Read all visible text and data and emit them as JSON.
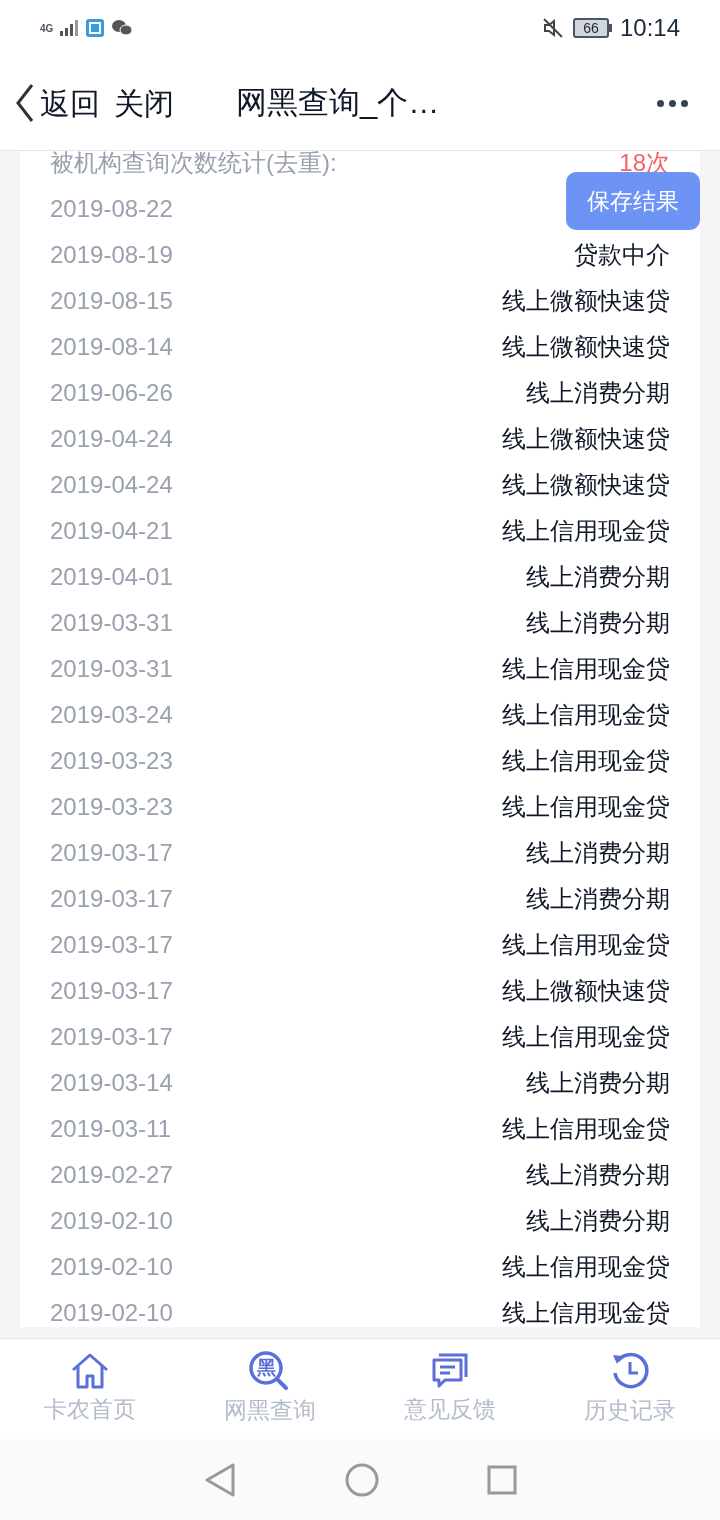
{
  "status_bar": {
    "network": "4G",
    "battery": "66",
    "time": "10:14"
  },
  "header": {
    "back": "返回",
    "close": "关闭",
    "title": "网黑查询_个…"
  },
  "summary": {
    "label": "被机构查询次数统计(去重):",
    "value": "18次"
  },
  "save_button": "保存结果",
  "rows": [
    {
      "date": "2019-08-22"
    },
    {
      "date": "2019-08-19",
      "type": "贷款中介"
    },
    {
      "date": "2019-08-15",
      "type": "线上微额快速贷"
    },
    {
      "date": "2019-08-14",
      "type": "线上微额快速贷"
    },
    {
      "date": "2019-06-26",
      "type": "线上消费分期"
    },
    {
      "date": "2019-04-24",
      "type": "线上微额快速贷"
    },
    {
      "date": "2019-04-24",
      "type": "线上微额快速贷"
    },
    {
      "date": "2019-04-21",
      "type": "线上信用现金贷"
    },
    {
      "date": "2019-04-01",
      "type": "线上消费分期"
    },
    {
      "date": "2019-03-31",
      "type": "线上消费分期"
    },
    {
      "date": "2019-03-31",
      "type": "线上信用现金贷"
    },
    {
      "date": "2019-03-24",
      "type": "线上信用现金贷"
    },
    {
      "date": "2019-03-23",
      "type": "线上信用现金贷"
    },
    {
      "date": "2019-03-23",
      "type": "线上信用现金贷"
    },
    {
      "date": "2019-03-17",
      "type": "线上消费分期"
    },
    {
      "date": "2019-03-17",
      "type": "线上消费分期"
    },
    {
      "date": "2019-03-17",
      "type": "线上信用现金贷"
    },
    {
      "date": "2019-03-17",
      "type": "线上微额快速贷"
    },
    {
      "date": "2019-03-17",
      "type": "线上信用现金贷"
    },
    {
      "date": "2019-03-14",
      "type": "线上消费分期"
    },
    {
      "date": "2019-03-11",
      "type": "线上信用现金贷"
    },
    {
      "date": "2019-02-27",
      "type": "线上消费分期"
    },
    {
      "date": "2019-02-10",
      "type": "线上消费分期"
    },
    {
      "date": "2019-02-10",
      "type": "线上信用现金贷"
    },
    {
      "date": "2019-02-10",
      "type": "线上信用现金贷"
    }
  ],
  "tab_bar": [
    {
      "kind": "home",
      "label": "卡农首页"
    },
    {
      "kind": "search",
      "label": "网黑查询",
      "icon_text": "黑"
    },
    {
      "kind": "feedback",
      "label": "意见反馈"
    },
    {
      "kind": "history",
      "label": "历史记录"
    }
  ]
}
